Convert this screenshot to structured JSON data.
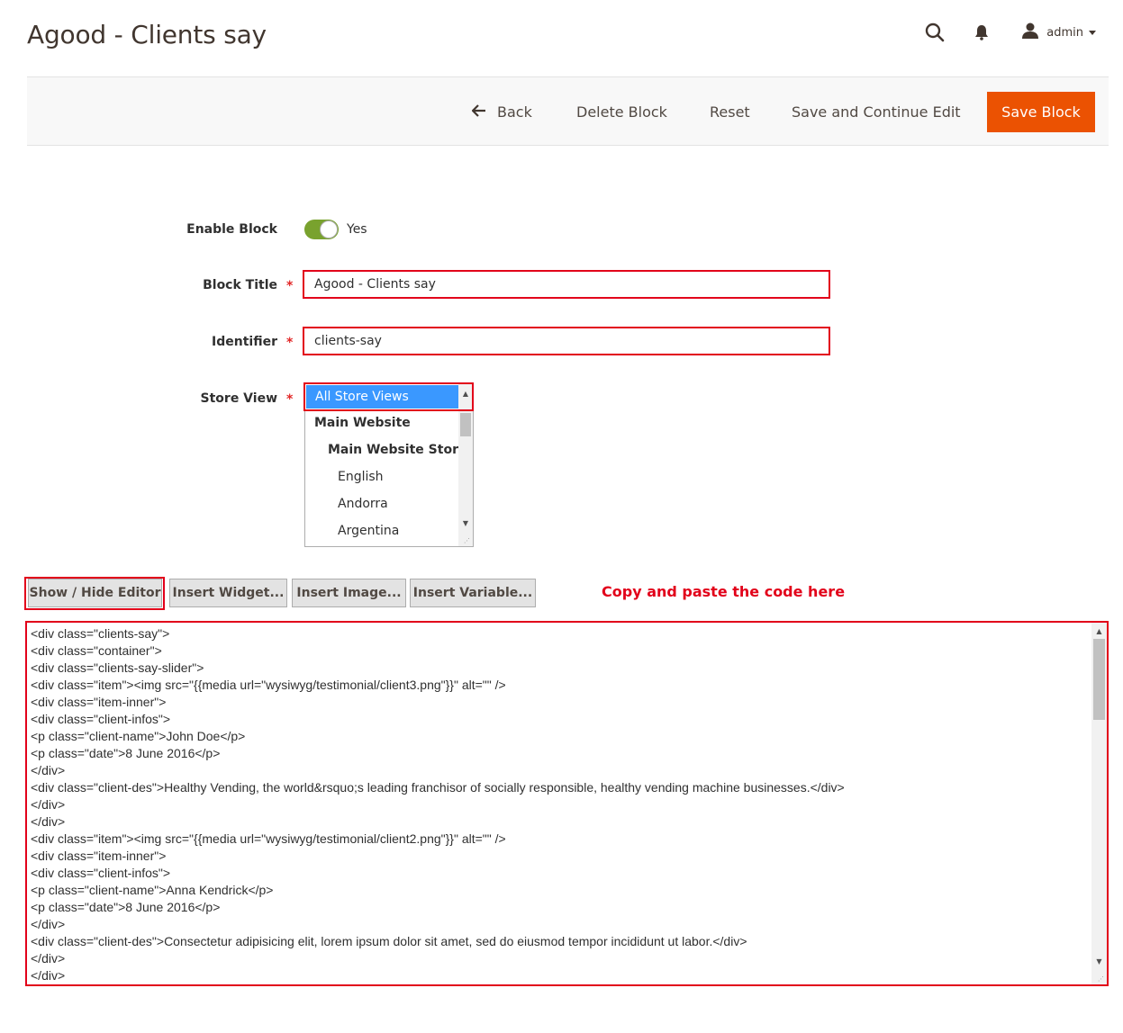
{
  "header": {
    "title": "Agood - Clients say",
    "user": "admin",
    "icons": [
      "search-icon",
      "bell-icon",
      "user-icon"
    ]
  },
  "toolbar": {
    "back_label": "Back",
    "delete_label": "Delete Block",
    "reset_label": "Reset",
    "save_continue_label": "Save and Continue Edit",
    "save_label": "Save Block"
  },
  "form": {
    "enable": {
      "label": "Enable Block",
      "value": "Yes",
      "on": true
    },
    "title": {
      "label": "Block Title",
      "value": "Agood - Clients say"
    },
    "identifier": {
      "label": "Identifier",
      "value": "clients-say"
    },
    "store_view": {
      "label": "Store View",
      "options": [
        "All Store Views",
        "Main Website",
        "Main Website Store",
        "English",
        "Andorra",
        "Argentina"
      ],
      "selected": "All Store Views"
    },
    "required_mark": "*"
  },
  "editor": {
    "show_hide_label": "Show / Hide Editor",
    "insert_widget_label": "Insert Widget...",
    "insert_image_label": "Insert Image...",
    "insert_variable_label": "Insert Variable...",
    "hint": "Copy and paste the code here",
    "content": "<div class=\"clients-say\">\n<div class=\"container\">\n<div class=\"clients-say-slider\">\n<div class=\"item\"><img src=\"{{media url=\"wysiwyg/testimonial/client3.png\"}}\" alt=\"\" />\n<div class=\"item-inner\">\n<div class=\"client-infos\">\n<p class=\"client-name\">John Doe</p>\n<p class=\"date\">8 June 2016</p>\n</div>\n<div class=\"client-des\">Healthy Vending, the world&rsquo;s leading franchisor of socially responsible, healthy vending machine businesses.</div>\n</div>\n</div>\n<div class=\"item\"><img src=\"{{media url=\"wysiwyg/testimonial/client2.png\"}}\" alt=\"\" />\n<div class=\"item-inner\">\n<div class=\"client-infos\">\n<p class=\"client-name\">Anna Kendrick</p>\n<p class=\"date\">8 June 2016</p>\n</div>\n<div class=\"client-des\">Consectetur adipisicing elit, lorem ipsum dolor sit amet, sed do eiusmod tempor incididunt ut labor.</div>\n</div>\n</div>"
  },
  "colors": {
    "accent": "#eb5202",
    "highlight": "#e2001a",
    "toggle_on": "#79a22e",
    "selected_option": "#3a98ff"
  }
}
